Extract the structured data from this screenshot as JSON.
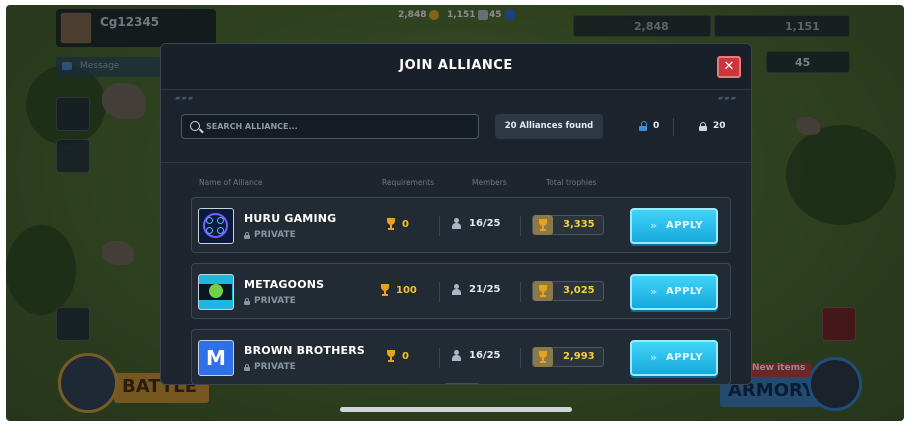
{
  "hud": {
    "player_name": "Cg12345",
    "message_label": "Message",
    "top_coins": "2,848",
    "top_crowns": "1,151",
    "top_gems": "45",
    "box_coins": "2,848",
    "box_crowns": "1,151",
    "box_gems": "45",
    "battle_label": "BATTLE",
    "armory_label": "ARMORY",
    "new_items_label": "New items"
  },
  "modal": {
    "title": "JOIN ALLIANCE",
    "close_icon": "close-icon",
    "search_placeholder": "SEARCH ALLIANCE...",
    "found_label": "20 Alliances found",
    "unlocked_count": "0",
    "locked_count": "20",
    "columns": {
      "name": "Name of Alliance",
      "requirements": "Requirements",
      "members": "Members",
      "trophies": "Total trophies"
    },
    "apply_label": "APPLY",
    "apply_chevron": "»",
    "alliances": [
      {
        "name": "HURU GAMING",
        "privacy": "PRIVATE",
        "requirement": "0",
        "members": "16/25",
        "trophies": "3,335"
      },
      {
        "name": "METAGOONS",
        "privacy": "PRIVATE",
        "requirement": "100",
        "members": "21/25",
        "trophies": "3,025"
      },
      {
        "name": "BROWN BROTHERS",
        "privacy": "PRIVATE",
        "requirement": "0",
        "members": "16/25",
        "trophies": "2,993"
      }
    ]
  },
  "colors": {
    "accent_apply": "#17a9dd",
    "close_red": "#c9373d",
    "trophy_gold": "#f3c22c"
  }
}
